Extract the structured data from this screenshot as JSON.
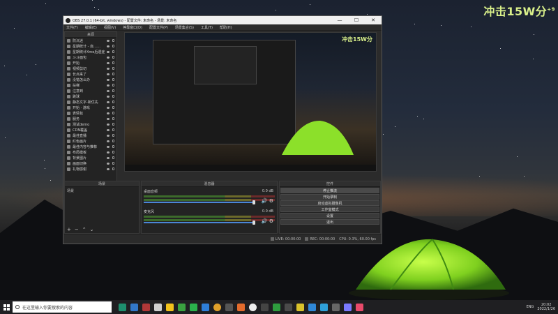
{
  "desktop": {
    "overlay_title": "冲击15W分",
    "overlay_sup": "+9"
  },
  "obs": {
    "title": "OBS 27.0.1 (64-bit, windows) - 配置文件: 未命名 - 场景: 未命名",
    "menu": [
      "文件(F)",
      "编辑(E)",
      "视图(V)",
      "停靠窗口(D)",
      "配置文件(P)",
      "场景集合(S)",
      "工具(T)",
      "帮助(H)"
    ],
    "sources_header": "来源",
    "sources": [
      "防沉迷",
      "星期统计 - 自……",
      "星期统计Xme后遗症",
      "斗斗面包",
      "开始",
      "视频剪切",
      "长点来了",
      "没错怎么办",
      "扶梯",
      "注意到",
      "跳球",
      "静态文字-新优先",
      "开始 · 游戏",
      "表情包",
      "服务",
      "测试demo",
      "CDN覆盖",
      "最佳直播",
      "红色画片",
      "最佳内容与推荐",
      "布局模板",
      "背景图片",
      "画面切换",
      "礼物感谢"
    ],
    "preview_overlay": "冲击15W分",
    "scenes_header": "场景",
    "scenes_item": "场景",
    "mixer_header": "混音器",
    "mixer": [
      {
        "name": "桌面音频",
        "db": "0.0 dB"
      },
      {
        "name": "麦克风",
        "db": "0.0 dB"
      }
    ],
    "controls_header": "控件",
    "controls": [
      "停止推流",
      "开始录制",
      "启动虚拟摄像机",
      "工作室模式",
      "设置",
      "退出"
    ],
    "status": {
      "live_label": "LIVE:",
      "live_time": "00:00:00",
      "rec_label": "REC:",
      "rec_time": "00:00:00",
      "cpu": "CPU: 0.3%, 60.00 fps"
    }
  },
  "taskbar": {
    "search_placeholder": "在这里输入你要搜索的内容",
    "tray_lang": "ENG",
    "time": "20:02",
    "date": "2022/1/26"
  },
  "colors": {
    "accent_green": "#d9f08a",
    "obs_bg": "#2b2b2b",
    "taskbar_bg": "#1f1f22"
  },
  "icons": [
    "windows-start-icon",
    "search-icon",
    "gear-icon",
    "speaker-icon",
    "eye-icon",
    "lock-icon"
  ]
}
